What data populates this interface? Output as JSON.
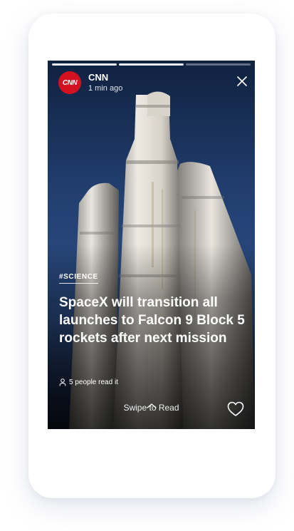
{
  "story": {
    "progress": {
      "segments": 3,
      "completed": 2
    },
    "source": {
      "name": "CNN",
      "avatar_text": "CNN",
      "time": "1 min ago",
      "brand_color": "#d4121f"
    },
    "close_icon": "close-icon",
    "tag": "#SCIENCE",
    "headline": "SpaceX will transition all launches to Falcon 9 Block 5 rockets after next mission",
    "readers": "5 people read it",
    "swipe_label": "Swipe to Read",
    "like_icon": "heart-icon"
  }
}
